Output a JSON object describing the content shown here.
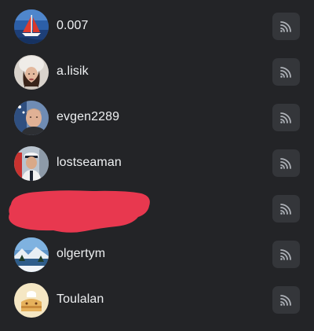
{
  "subscriptions": {
    "items": [
      {
        "username": "0.007",
        "avatar": "sailboat-avatar",
        "action_icon": "rss-feed-icon"
      },
      {
        "username": "a.lisik",
        "avatar": "woman-fur-hat-avatar",
        "action_icon": "rss-feed-icon"
      },
      {
        "username": "evgen2289",
        "avatar": "man-portrait-avatar",
        "action_icon": "rss-feed-icon"
      },
      {
        "username": "lostseaman",
        "avatar": "sailor-avatar",
        "action_icon": "rss-feed-icon"
      },
      {
        "username": "",
        "avatar": "redacted",
        "action_icon": "rss-feed-icon"
      },
      {
        "username": "olgertym",
        "avatar": "winter-landscape-avatar",
        "action_icon": "rss-feed-icon"
      },
      {
        "username": "Toulalan",
        "avatar": "sandwich-avatar",
        "action_icon": "rss-feed-icon"
      }
    ]
  },
  "colors": {
    "background": "#232427",
    "button_background": "#34363a",
    "icon": "#aeb2b8",
    "text": "#eef0f2",
    "redaction": "#e8384f"
  }
}
